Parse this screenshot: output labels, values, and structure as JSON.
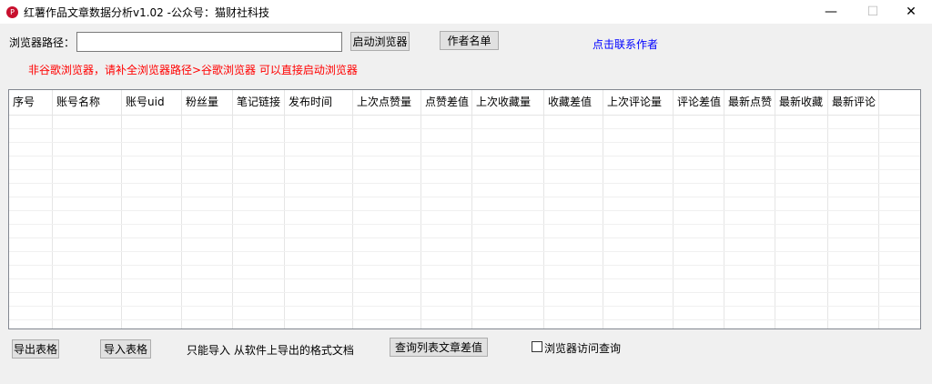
{
  "window": {
    "title": "红薯作品文章数据分析v1.02 -公众号：猫财社科技",
    "icon_text": "P",
    "minimize": "—",
    "maximize": "☐",
    "close": "✕"
  },
  "browser": {
    "path_label": "浏览器路径：",
    "path_value": "",
    "launch_button": "启动浏览器",
    "authors_button": "作者名单",
    "contact_link": "点击联系作者",
    "warning": "非谷歌浏览器，请补全浏览器路径>谷歌浏览器 可以直接启动浏览器"
  },
  "table": {
    "columns": [
      "序号",
      "账号名称",
      "账号uid",
      "粉丝量",
      "笔记链接",
      "发布时间",
      "上次点赞量",
      "点赞差值",
      "上次收藏量",
      "收藏差值",
      "上次评论量",
      "评论差值",
      "最新点赞",
      "最新收藏",
      "最新评论",
      ""
    ]
  },
  "footer": {
    "export_button": "导出表格",
    "import_button": "导入表格",
    "import_note": "只能导入 从软件上导出的格式文档",
    "query_button": "查询列表文章差值",
    "browser_query_label": "浏览器访问查询",
    "browser_query_checked": false
  },
  "colors": {
    "warning": "#ff0000",
    "link": "#0000ff",
    "window_bg": "#f0f0f0"
  }
}
